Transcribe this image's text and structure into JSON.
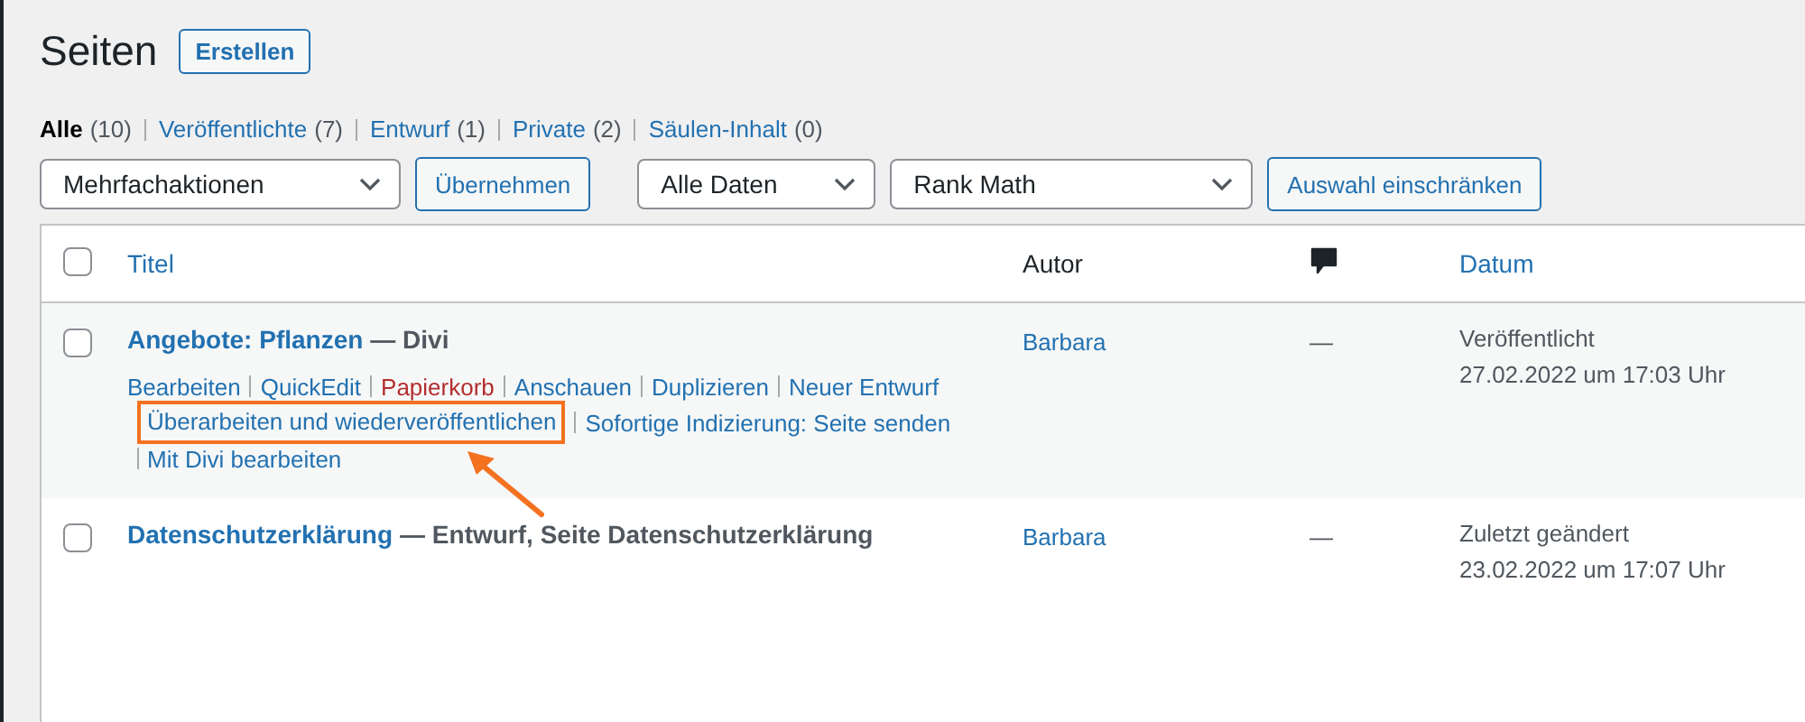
{
  "page": {
    "title": "Seiten",
    "add_button": "Erstellen"
  },
  "filters": [
    {
      "label": "Alle",
      "count": "(10)",
      "selected": true
    },
    {
      "label": "Veröffentlichte",
      "count": "(7)",
      "selected": false
    },
    {
      "label": "Entwurf",
      "count": "(1)",
      "selected": false
    },
    {
      "label": "Private",
      "count": "(2)",
      "selected": false
    },
    {
      "label": "Säulen-Inhalt",
      "count": "(0)",
      "selected": false
    }
  ],
  "toolbar": [
    {
      "kind": "select",
      "value": "Mehrfachaktionen"
    },
    {
      "kind": "button",
      "label": "Übernehmen"
    },
    {
      "kind": "select",
      "value": "Alle Daten"
    },
    {
      "kind": "select",
      "value": "Rank Math"
    },
    {
      "kind": "button",
      "label": "Auswahl einschränken"
    }
  ],
  "table": {
    "header_checked": false,
    "columns": [
      "Titel",
      "Autor",
      "Datum"
    ],
    "rows": [
      {
        "checked": false,
        "title": "Angebote: Pflanzen",
        "state": "— Divi",
        "hover": true,
        "action_lines": [
          [
            {
              "label": "Bearbeiten",
              "kind": "link",
              "highlighted": false
            },
            {
              "label": "QuickEdit",
              "kind": "link",
              "highlighted": false
            },
            {
              "label": "Papierkorb",
              "kind": "delete",
              "highlighted": false
            },
            {
              "label": "Anschauen",
              "kind": "link",
              "highlighted": false
            },
            {
              "label": "Duplizieren",
              "kind": "link",
              "highlighted": false
            },
            {
              "label": "Neuer Entwurf",
              "kind": "link",
              "highlighted": false
            }
          ],
          [
            {
              "label": "Überarbeiten und wiederveröffentlichen",
              "kind": "link",
              "highlighted": true
            },
            {
              "label": "Sofortige Indizierung: Seite senden",
              "kind": "link",
              "highlighted": false
            }
          ],
          [
            {
              "label": "Mit Divi bearbeiten",
              "kind": "link",
              "highlighted": false
            }
          ]
        ],
        "author": "Barbara",
        "comments": "—",
        "status": "Veröffentlicht",
        "date": "27.02.2022 um 17:03 Uhr"
      },
      {
        "checked": false,
        "title": "Datenschutzerklärung",
        "state": "— Entwurf, Seite Datenschutzerklärung",
        "hover": false,
        "author": "Barbara",
        "comments": "—",
        "status": "Zuletzt geändert",
        "date": "23.02.2022 um 17:07 Uhr"
      }
    ]
  }
}
